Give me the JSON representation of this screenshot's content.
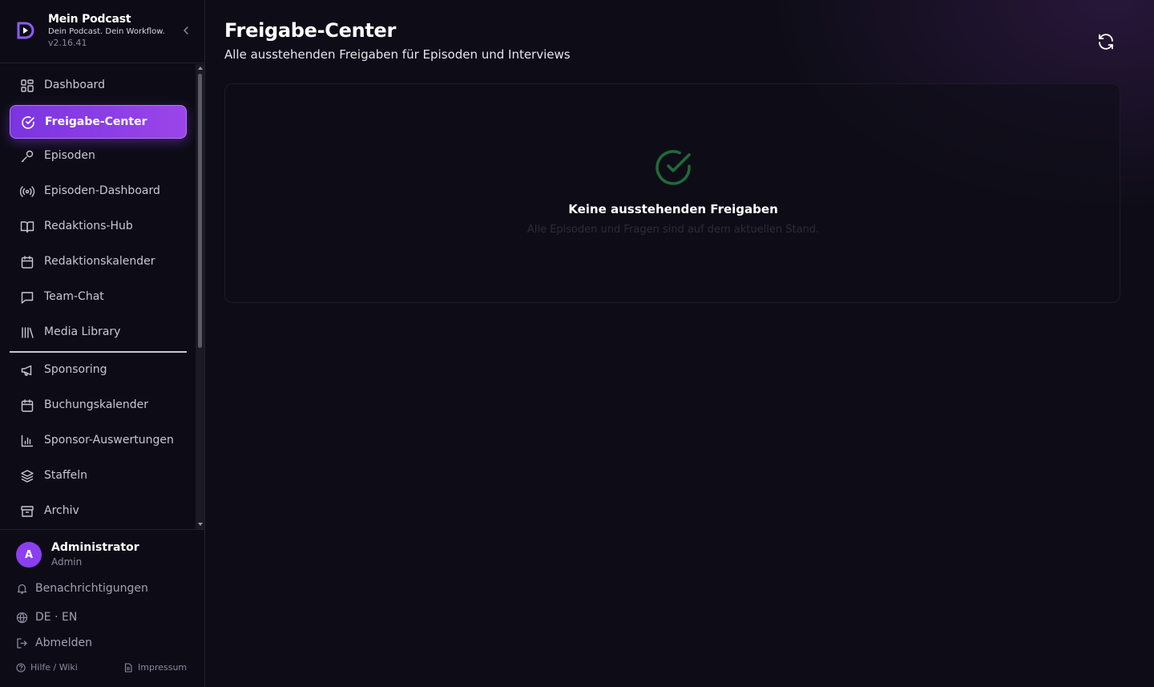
{
  "brand": {
    "title": "Mein Podcast",
    "tagline": "Dein Podcast. Dein Workflow.",
    "version": "v2.16.41",
    "accent_color": "#8b3ff0"
  },
  "sidebar": {
    "items": [
      {
        "label": "Dashboard",
        "icon": "dashboard-grid-icon",
        "active": false
      },
      {
        "label": "Freigabe-Center",
        "icon": "check-circle-icon",
        "active": true
      },
      {
        "label": "Episoden",
        "icon": "link-icon",
        "active": false
      },
      {
        "label": "Episoden-Dashboard",
        "icon": "radio-broadcast-icon",
        "active": false
      },
      {
        "label": "Redaktions-Hub",
        "icon": "book-open-icon",
        "active": false
      },
      {
        "label": "Redaktionskalender",
        "icon": "calendar-icon",
        "active": false
      },
      {
        "label": "Team-Chat",
        "icon": "chat-bubble-icon",
        "active": false
      },
      {
        "label": "Media Library",
        "icon": "library-icon",
        "active": false
      },
      {
        "label": "Sponsoring",
        "icon": "megaphone-icon",
        "active": false
      },
      {
        "label": "Buchungskalender",
        "icon": "calendar-icon",
        "active": false
      },
      {
        "label": "Sponsor-Auswertungen",
        "icon": "bar-chart-icon",
        "active": false
      },
      {
        "label": "Staffeln",
        "icon": "layers-icon",
        "active": false
      },
      {
        "label": "Archiv",
        "icon": "archive-box-icon",
        "active": false
      }
    ]
  },
  "user": {
    "initial": "A",
    "name": "Administrator",
    "role": "Admin"
  },
  "footer": {
    "notifications": "Benachrichtigungen",
    "language": "DE · EN",
    "logout": "Abmelden",
    "help": "Hilfe / Wiki",
    "imprint": "Impressum"
  },
  "main": {
    "title": "Freigabe-Center",
    "subtitle": "Alle ausstehenden Freigaben für Episoden und Interviews",
    "empty_title": "Keine ausstehenden Freigaben",
    "empty_desc": "Alle Episoden und Fragen sind auf dem aktuellen Stand.",
    "success_color": "#1f6b3a"
  }
}
